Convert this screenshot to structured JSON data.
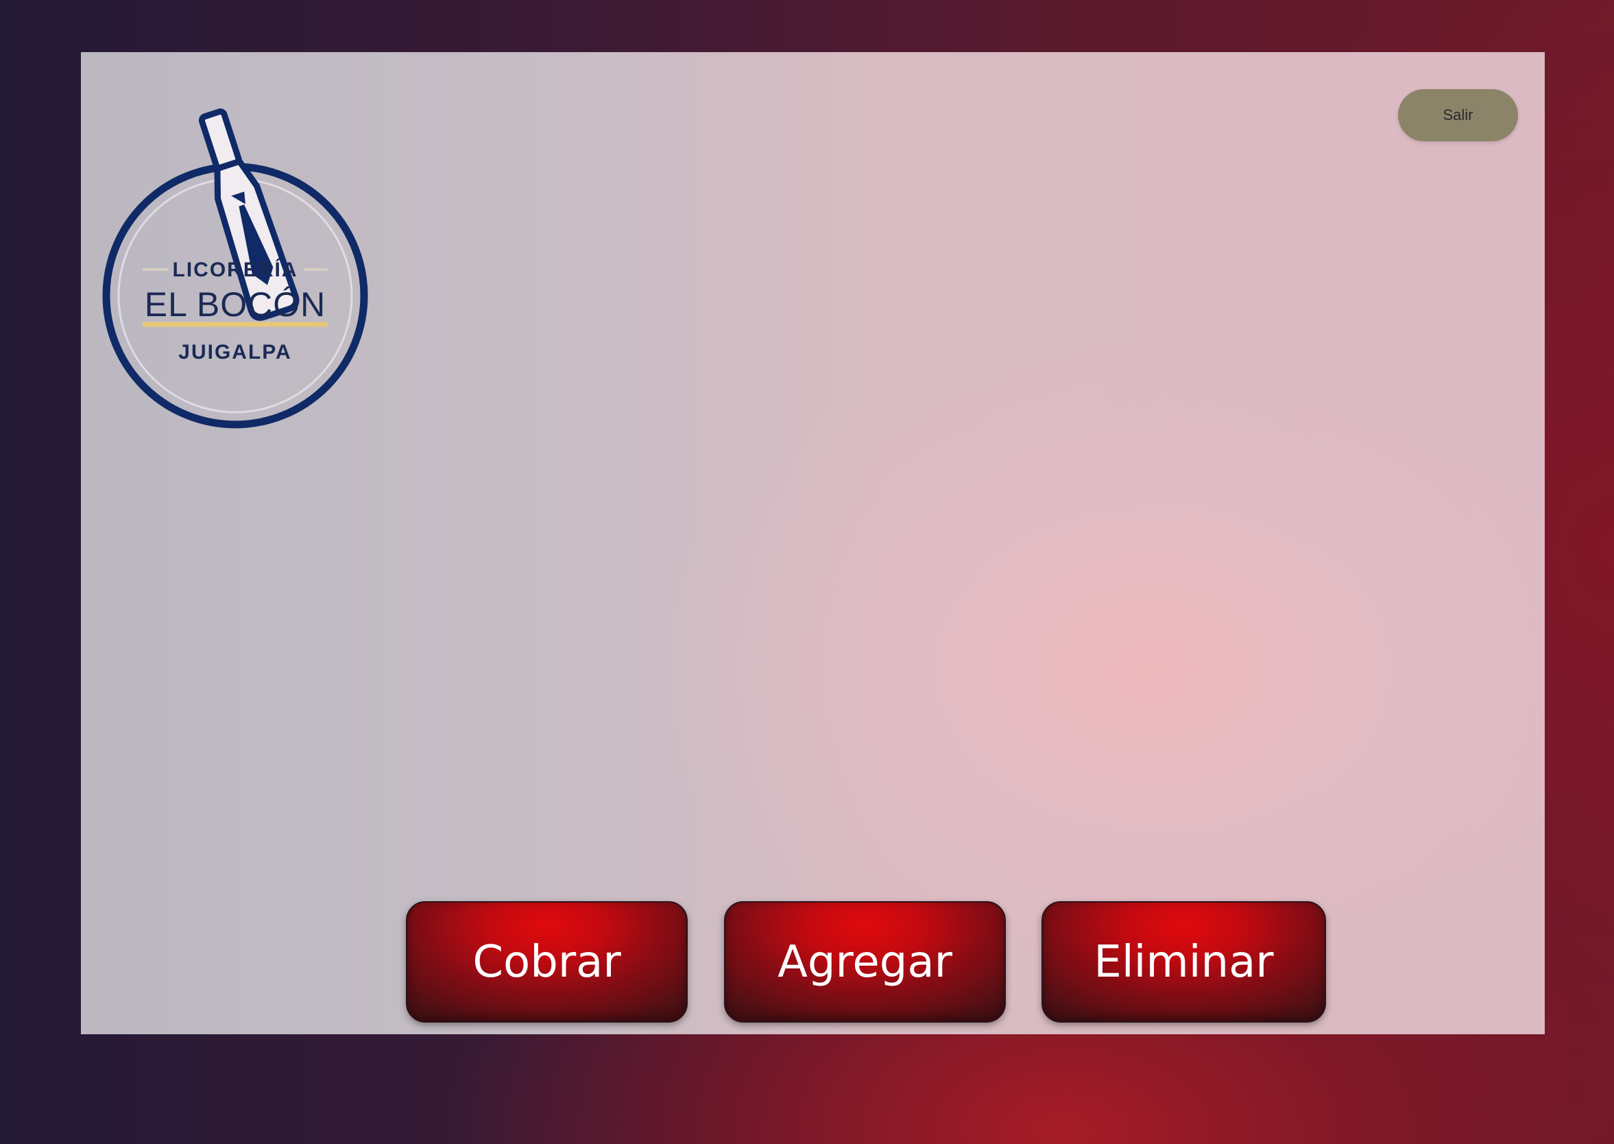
{
  "logo": {
    "line1": "LICORERÍA",
    "line2": "EL BOCÓN",
    "line3": "JUIGALPA",
    "icon": "bottle-with-tie-icon",
    "colors": {
      "primary": "#0f2a66",
      "accent": "#e6c878"
    }
  },
  "header": {
    "exit_label": "Salir"
  },
  "actions": {
    "cobrar_label": "Cobrar",
    "agregar_label": "Agregar",
    "eliminar_label": "Eliminar"
  },
  "colors": {
    "action_button": "#d00a0c",
    "exit_button": "#8b8468",
    "panel": "#d6bcc4"
  }
}
